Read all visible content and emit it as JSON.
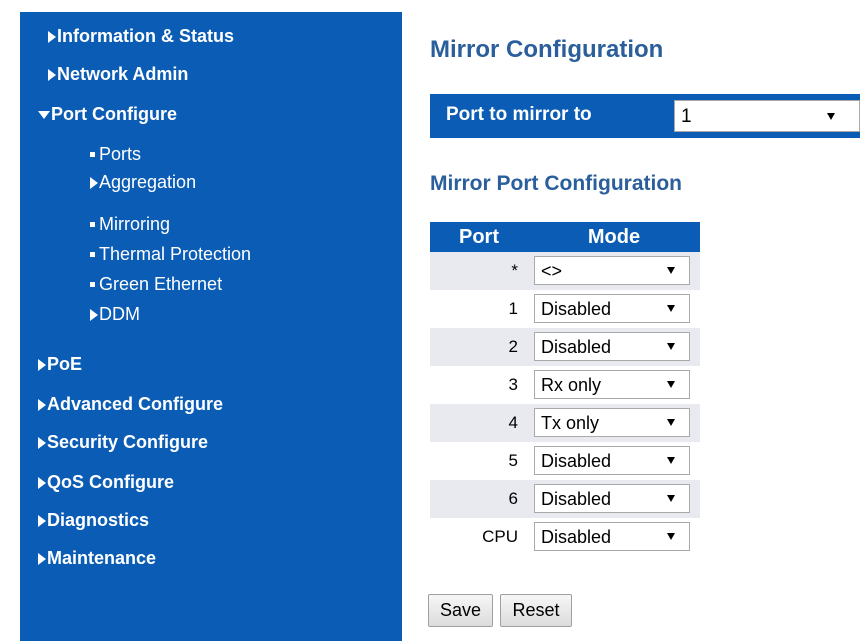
{
  "sidebar": {
    "items": [
      {
        "label": "Information & Status"
      },
      {
        "label": "Network Admin"
      },
      {
        "label": "Port Configure"
      },
      {
        "label": "Ports"
      },
      {
        "label": "Aggregation"
      },
      {
        "label": "Mirroring"
      },
      {
        "label": "Thermal Protection"
      },
      {
        "label": "Green Ethernet"
      },
      {
        "label": "DDM"
      },
      {
        "label": "PoE"
      },
      {
        "label": "Advanced Configure"
      },
      {
        "label": "Security Configure"
      },
      {
        "label": "QoS Configure"
      },
      {
        "label": "Diagnostics"
      },
      {
        "label": "Maintenance"
      }
    ]
  },
  "main": {
    "title": "Mirror Configuration",
    "mirror_port": {
      "label": "Port to mirror to",
      "value": "1"
    },
    "subtitle": "Mirror Port Configuration",
    "table": {
      "headers": [
        "Port",
        "Mode"
      ],
      "rows": [
        {
          "port": "*",
          "mode": "<>"
        },
        {
          "port": "1",
          "mode": "Disabled"
        },
        {
          "port": "2",
          "mode": "Disabled"
        },
        {
          "port": "3",
          "mode": "Rx only"
        },
        {
          "port": "4",
          "mode": "Tx only"
        },
        {
          "port": "5",
          "mode": "Disabled"
        },
        {
          "port": "6",
          "mode": "Disabled"
        },
        {
          "port": "CPU",
          "mode": "Disabled"
        }
      ]
    },
    "buttons": {
      "save": "Save",
      "reset": "Reset"
    }
  },
  "colors": {
    "sidebar_bg": "#0a5cb5",
    "heading": "#2a5f9c",
    "row_alt": "#e8eaf0"
  }
}
